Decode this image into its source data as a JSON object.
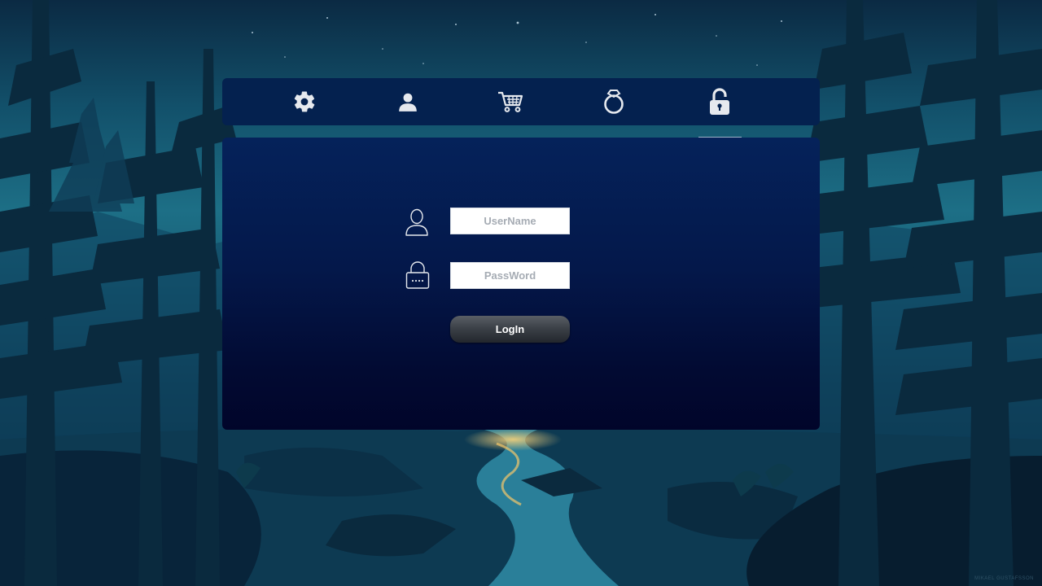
{
  "nav": {
    "items": [
      {
        "id": "settings",
        "icon": "gear-icon"
      },
      {
        "id": "user",
        "icon": "user-icon"
      },
      {
        "id": "cart",
        "icon": "cart-icon"
      },
      {
        "id": "ring",
        "icon": "ring-icon"
      },
      {
        "id": "lock",
        "icon": "padlock-icon"
      }
    ],
    "active": "lock"
  },
  "login": {
    "username_placeholder": "UserName",
    "username_value": "",
    "password_placeholder": "PassWord",
    "password_value": "",
    "login_label": "LogIn"
  },
  "background": {
    "credit": "MIKAEL GUSTAFSSON"
  },
  "colors": {
    "nav_bg": "#04214f",
    "panel_top": "#05225a",
    "panel_bottom": "#01052a",
    "button": "#3c4148",
    "icon": "#e6e9ee"
  }
}
